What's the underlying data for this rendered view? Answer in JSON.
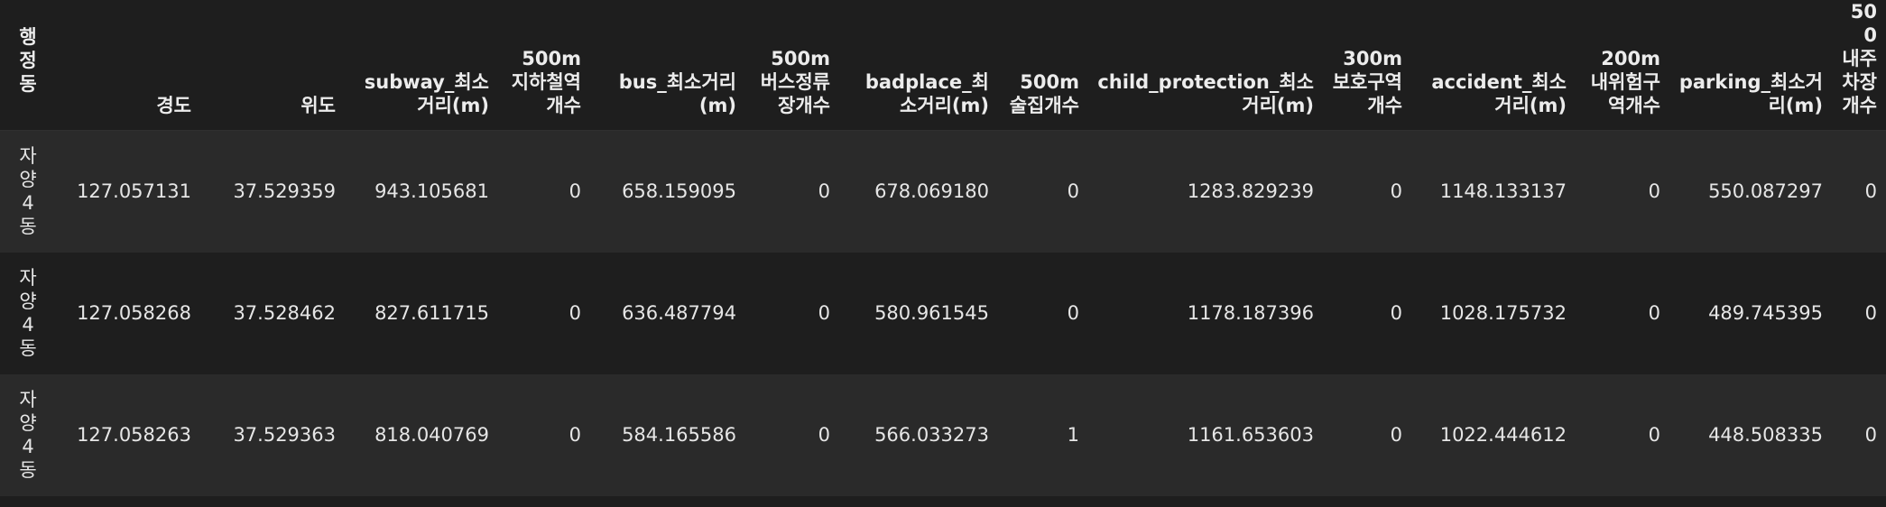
{
  "table": {
    "index_header": "행정동",
    "columns": [
      "경도",
      "위도",
      "subway_최소거리(m)",
      "500m 지하철역개수",
      "bus_최소거리(m)",
      "500m 버스정류장개수",
      "badplace_최소거리(m)",
      "500m 술집개수",
      "child_protection_최소거리(m)",
      "300m 보호구역개수",
      "accident_최소거리(m)",
      "200m 내위험구역개수",
      "parking_최소거리(m)",
      "500 내주차장개수"
    ],
    "rows": [
      {
        "index": "자양4동",
        "cells": [
          "127.057131",
          "37.529359",
          "943.105681",
          "0",
          "658.159095",
          "0",
          "678.069180",
          "0",
          "1283.829239",
          "0",
          "1148.133137",
          "0",
          "550.087297",
          "0"
        ]
      },
      {
        "index": "자양4동",
        "cells": [
          "127.058268",
          "37.528462",
          "827.611715",
          "0",
          "636.487794",
          "0",
          "580.961545",
          "0",
          "1178.187396",
          "0",
          "1028.175732",
          "0",
          "489.745395",
          "0"
        ]
      },
      {
        "index": "자양4동",
        "cells": [
          "127.058263",
          "37.529363",
          "818.040769",
          "0",
          "584.165586",
          "0",
          "566.033273",
          "1",
          "1161.653603",
          "0",
          "1022.444612",
          "0",
          "448.508335",
          "0"
        ]
      }
    ]
  }
}
